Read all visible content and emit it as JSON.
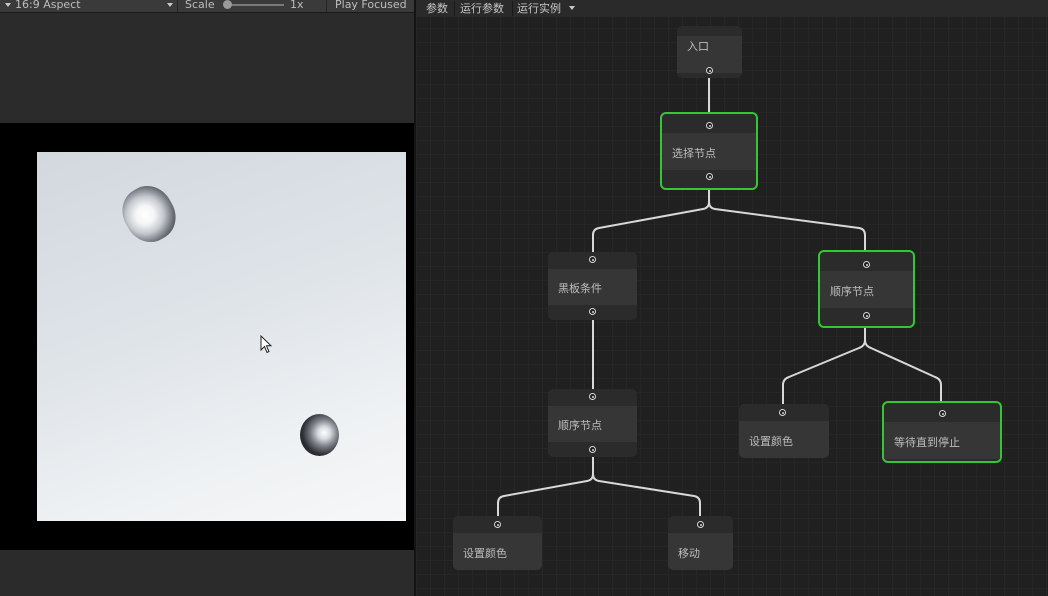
{
  "game_toolbar": {
    "aspect": "16:9 Aspect",
    "scale_label": "Scale",
    "scale_value": "1x",
    "play_mode": "Play Focused"
  },
  "graph_toolbar": {
    "tabs": [
      "参数",
      "运行参数",
      "运行实例"
    ]
  },
  "graph": {
    "nodes": {
      "entry": "入口",
      "selector": "选择节点",
      "blackboard": "黑板条件",
      "sequence_right": "顺序节点",
      "sequence_left": "顺序节点",
      "set_color_right": "设置颜色",
      "wait_stop": "等待直到停止",
      "set_color_left": "设置颜色",
      "move": "移动"
    }
  },
  "colors": {
    "selection": "#35c635",
    "edge": "#d8d8d8",
    "graph_bg": "#202020"
  }
}
